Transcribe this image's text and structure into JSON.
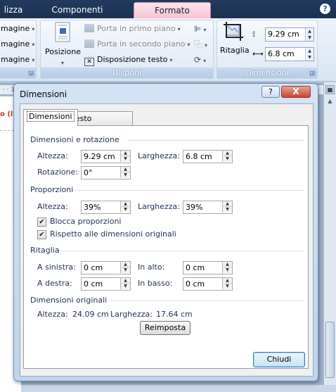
{
  "ribbon": {
    "tabs": [
      "lizza",
      "Componenti aggiuntivi",
      "Formato"
    ],
    "left_group_items": [
      "magine",
      "magine",
      "magine"
    ],
    "disponi": {
      "position_label": "Posizione",
      "bring_forward": "Porta in primo piano",
      "send_backward": "Porta in secondo piano",
      "text_wrap": "Disposizione testo",
      "group_label": "Disponi"
    },
    "dimensioni": {
      "crop_label": "Ritaglia",
      "height_value": "9.29 cm",
      "width_value": "6.8 cm",
      "group_label": "Dimensioni"
    }
  },
  "document": {
    "ruler_text": "·  ·  1",
    "snippet": "o (lu"
  },
  "dialog": {
    "title": "Dimensioni",
    "help_glyph": "?",
    "close_glyph": "X",
    "tabs": [
      "Dimensioni",
      "Testo alternativo"
    ],
    "section_size_rotation": "Dimensioni e rotazione",
    "label_height": "Altezza:",
    "label_width": "Larghezza:",
    "label_rotation": "Rotazione:",
    "height": "9.29 cm",
    "width": "6.8 cm",
    "rotation": "0°",
    "section_proportions": "Proporzioni",
    "scale_height": "39%",
    "scale_width": "39%",
    "lock_aspect_label": "Blocca proporzioni",
    "lock_aspect_checked": true,
    "relative_original_label": "Rispetto alle dimensioni originali",
    "relative_original_checked": true,
    "section_crop": "Ritaglia",
    "label_left": "A sinistra:",
    "label_right": "A destra:",
    "label_top": "In alto:",
    "label_bottom": "In basso:",
    "crop_left": "0 cm",
    "crop_right": "0 cm",
    "crop_top": "0 cm",
    "crop_bottom": "0 cm",
    "section_original": "Dimensioni originali",
    "original_height_label": "Altezza:",
    "original_height": "24.09 cm",
    "original_width_label": "Larghezza:",
    "original_width": "17.64 cm",
    "reset_button": "Reimposta",
    "close_button": "Chiudi"
  }
}
